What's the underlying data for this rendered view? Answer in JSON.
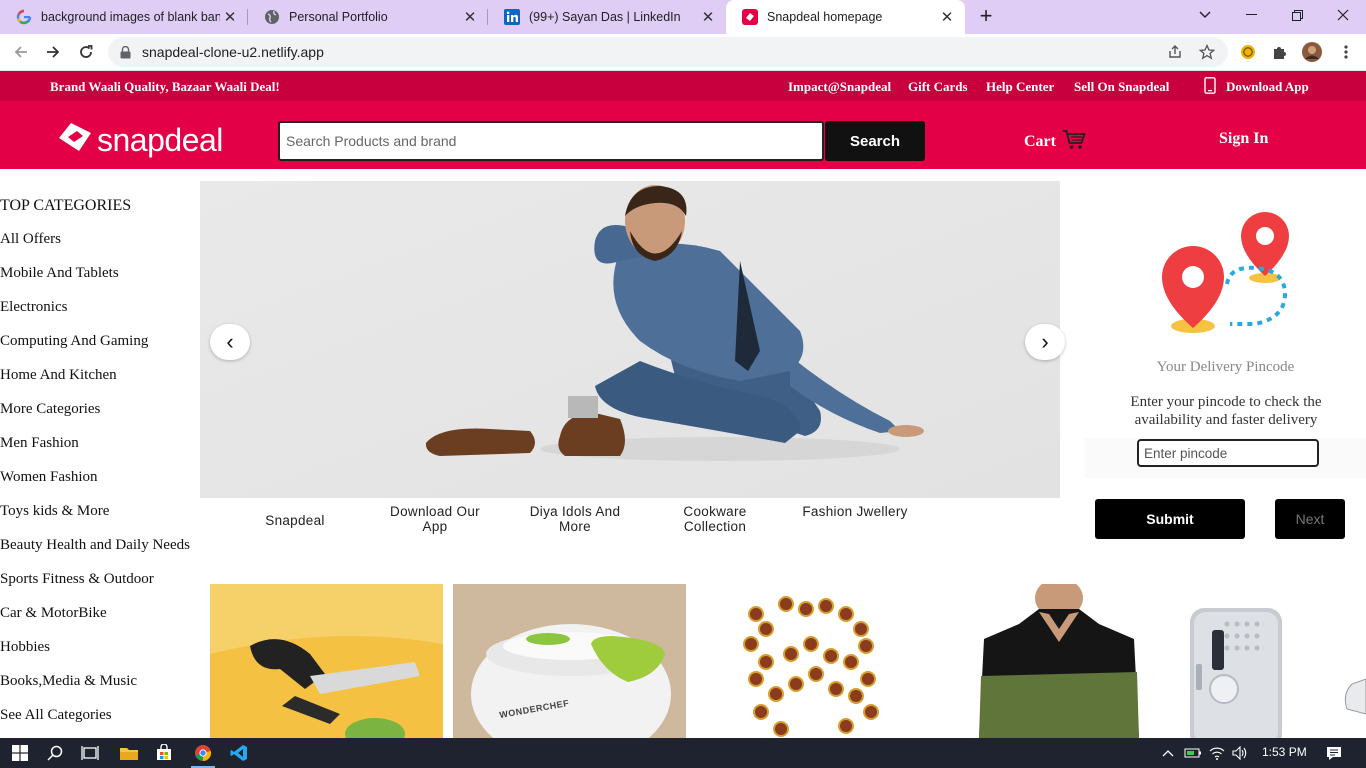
{
  "browser": {
    "tabs": [
      {
        "title": "background images of blank banner",
        "favicon": "google-g-icon"
      },
      {
        "title": "Personal Portfolio",
        "favicon": "globe-icon"
      },
      {
        "title": "(99+) Sayan Das | LinkedIn",
        "favicon": "linkedin-icon"
      },
      {
        "title": "Snapdeal homepage",
        "favicon": "snapdeal-icon"
      }
    ],
    "url": "snapdeal-clone-u2.netlify.app"
  },
  "topbar": {
    "tagline": "Brand Waali Quality, Bazaar Waali Deal!",
    "links": [
      "Impact@Snapdeal",
      "Gift Cards",
      "Help Center",
      "Sell On Snapdeal",
      "Download App"
    ]
  },
  "header": {
    "logo_text": "snapdeal",
    "search_placeholder": "Search Products and brand",
    "search_button": "Search",
    "cart_label": "Cart",
    "signin_label": "Sign In"
  },
  "sidebar": {
    "heading": "TOP CATEGORIES",
    "items": [
      "All Offers",
      "Mobile And Tablets",
      "Electronics",
      "Computing And Gaming",
      "Home And Kitchen",
      "More Categories",
      "Men Fashion",
      "Women Fashion",
      "Toys kids & More",
      "Beauty Health and Daily Needs",
      "Sports Fitness & Outdoor",
      "Car & MotorBike",
      "Hobbies",
      "Books,Media & Music",
      "See All Categories"
    ]
  },
  "banner": {
    "prev": "‹",
    "next": "›",
    "thumbs": [
      "Snapdeal",
      "Download Our App",
      "Diya Idols And More",
      "Cookware Collection",
      "Fashion Jwellery"
    ]
  },
  "pincode": {
    "title": "Your Delivery Pincode",
    "description": "Enter your pincode to check the availability and faster delivery",
    "placeholder": "Enter pincode",
    "submit": "Submit",
    "next": "Next"
  },
  "products": {
    "wonderchef_label": "WONDERCHEF"
  },
  "taskbar": {
    "time": "1:53 PM"
  },
  "colors": {
    "brand": "#e40046",
    "brand_dark": "#c9003e",
    "tab_strip": "#dfcdf5"
  }
}
